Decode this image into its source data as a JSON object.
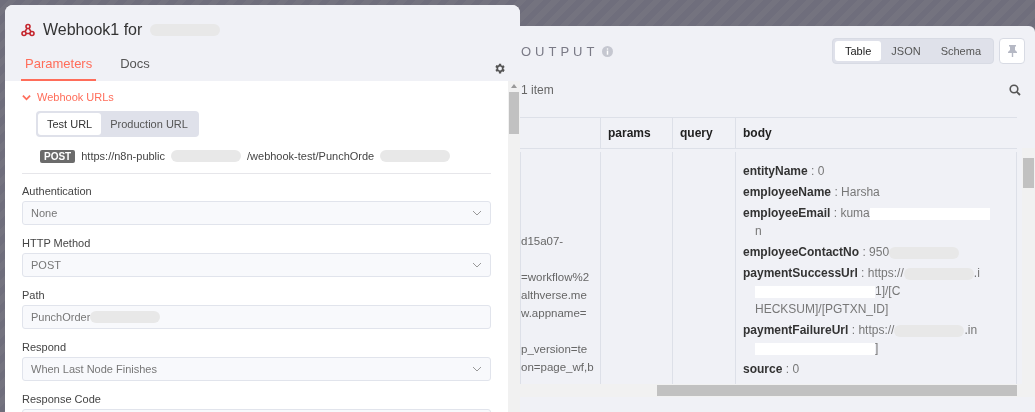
{
  "node_panel": {
    "title": [
      {
        "text": "Webhook1 for"
      },
      {
        "kind": "redacted"
      }
    ],
    "tabs": [
      {
        "label": "Parameters",
        "selected": true
      },
      {
        "label": "Docs",
        "selected": false
      }
    ],
    "section": {
      "title": "Webhook URLs",
      "expanded": true
    },
    "url_tabs": [
      {
        "label": "Test URL",
        "selected": true
      },
      {
        "label": "Production URL",
        "selected": false
      }
    ],
    "method_badge": "POST",
    "url": [
      {
        "text": "https://n8n-public"
      },
      {
        "kind": "redacted"
      },
      {
        "text": "/webhook-test/PunchOrde"
      },
      {
        "kind": "redacted"
      }
    ],
    "fields": [
      {
        "label": "Authentication",
        "kind": "select",
        "value": [
          {
            "text": "None"
          }
        ]
      },
      {
        "label": "HTTP Method",
        "kind": "select",
        "value": [
          {
            "text": "POST"
          }
        ]
      },
      {
        "label": "Path",
        "kind": "text",
        "value": [
          {
            "text": "PunchOrder"
          },
          {
            "kind": "redacted"
          }
        ]
      },
      {
        "label": "Respond",
        "kind": "select",
        "value": [
          {
            "text": "When Last Node Finishes"
          }
        ]
      },
      {
        "label": "Response Code",
        "kind": "text"
      }
    ]
  },
  "output_panel": {
    "title": "OUTPUT",
    "views": [
      {
        "label": "Table",
        "selected": true
      },
      {
        "label": "JSON",
        "selected": false
      },
      {
        "label": "Schema",
        "selected": false
      }
    ],
    "item_count": "1 item",
    "table": {
      "columns": [
        "params",
        "query",
        "body"
      ],
      "column_1_blocks": [
        [
          "d15a07-"
        ],
        [
          "=workflow%2",
          "althverse.me",
          "w.appname="
        ],
        [
          "p_version=te",
          "on=page_wf,b"
        ]
      ],
      "body": [
        {
          "key": "entityName",
          "separator": ":",
          "lines": [
            [
              {
                "text": "0"
              }
            ]
          ]
        },
        {
          "key": "employeeName",
          "separator": ":",
          "lines": [
            [
              {
                "text": "Harsha"
              }
            ]
          ]
        },
        {
          "key": "employeeEmail",
          "separator": ":",
          "lines": [
            [
              {
                "text": "kuma"
              },
              {
                "kind": "white"
              }
            ],
            [
              {
                "text": "n"
              }
            ]
          ]
        },
        {
          "key": "employeeContactNo",
          "separator": ":",
          "lines": [
            [
              {
                "text": "950"
              },
              {
                "kind": "redacted"
              }
            ]
          ]
        },
        {
          "key": "paymentSuccessUrl",
          "separator": ":",
          "lines": [
            [
              {
                "text": "https://"
              },
              {
                "kind": "redacted"
              },
              {
                "text": ".i"
              }
            ],
            [
              {
                "kind": "white"
              },
              {
                "text": "1]/[C"
              }
            ],
            [
              {
                "text": "HECKSUM]/[PGTXN_ID]"
              }
            ]
          ]
        },
        {
          "key": "paymentFailureUrl",
          "separator": ":",
          "lines": [
            [
              {
                "text": "https://"
              },
              {
                "kind": "redacted"
              },
              {
                "text": ".in"
              }
            ],
            [
              {
                "kind": "white"
              },
              {
                "text": "]"
              }
            ]
          ]
        },
        {
          "key": "source",
          "separator": ":",
          "lines": [
            [
              {
                "text": "0"
              }
            ]
          ]
        }
      ]
    }
  }
}
